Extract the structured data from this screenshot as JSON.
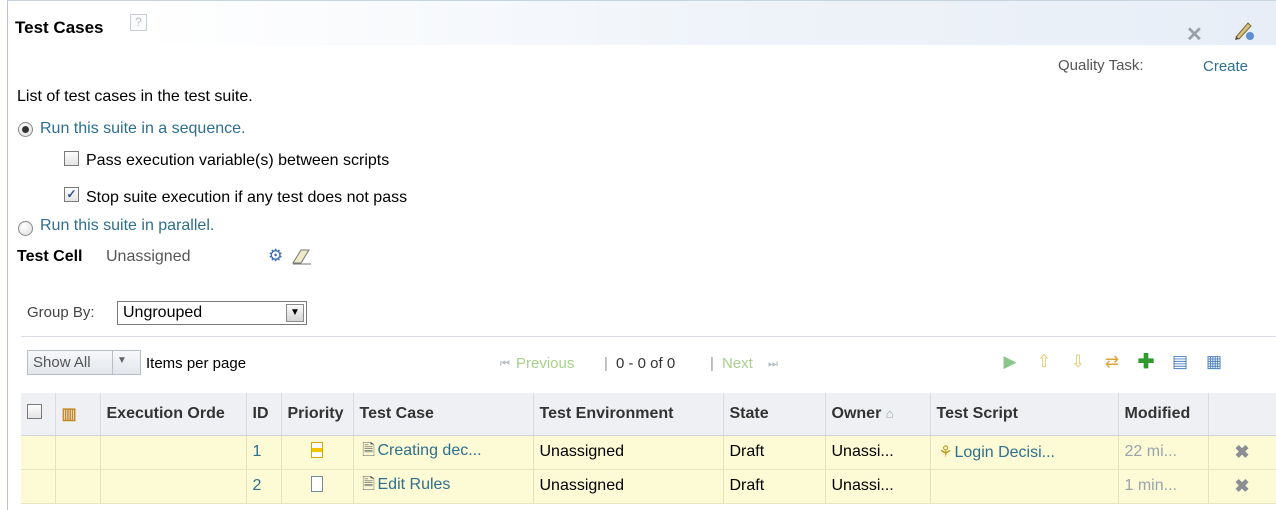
{
  "panel": {
    "title": "Test Cases",
    "help_icon": "?",
    "quality_task_label": "Quality Task:",
    "create_link": "Create"
  },
  "description": "List of test cases in the test suite.",
  "execution": {
    "sequence_label": "Run this suite in a sequence.",
    "pass_vars_label": "Pass execution variable(s) between scripts",
    "pass_vars_checked": false,
    "stop_label": "Stop suite execution if any test does not pass",
    "stop_checked": true,
    "parallel_label": "Run this suite in parallel.",
    "selected": "sequence"
  },
  "test_cell": {
    "label": "Test Cell",
    "value": "Unassigned"
  },
  "group_by": {
    "label": "Group By:",
    "value": "Ungrouped"
  },
  "toolbar": {
    "show_all": "Show All",
    "items_per_page": "Items per page",
    "previous": "Previous",
    "range": "0 - 0 of 0",
    "next": "Next",
    "icons": [
      "run-icon",
      "move-up-icon",
      "move-down-icon",
      "refresh-icon",
      "add-icon",
      "export-icon",
      "columns-icon"
    ]
  },
  "table": {
    "columns": [
      "",
      "",
      "Execution Orde",
      "ID",
      "Priority",
      "Test Case",
      "Test Environment",
      "State",
      "Owner",
      "Test Script",
      "Modified",
      ""
    ],
    "rows": [
      {
        "id": "1",
        "priority_icon": "priority-medium-icon",
        "test_case": "Creating dec...",
        "environment": "Unassigned",
        "state": "Draft",
        "owner": "Unassi...",
        "script": "Login Decisi...",
        "modified": "22 mi..."
      },
      {
        "id": "2",
        "priority_icon": "priority-unassigned-icon",
        "test_case": "Edit Rules",
        "environment": "Unassigned",
        "state": "Draft",
        "owner": "Unassi...",
        "script": "",
        "modified": "1 min..."
      }
    ]
  },
  "colors": {
    "link": "#2e6f8e",
    "row_highlight": "#fcfbd5",
    "header_bg": "#eef0f3",
    "disabled_link": "#a8d08a"
  }
}
